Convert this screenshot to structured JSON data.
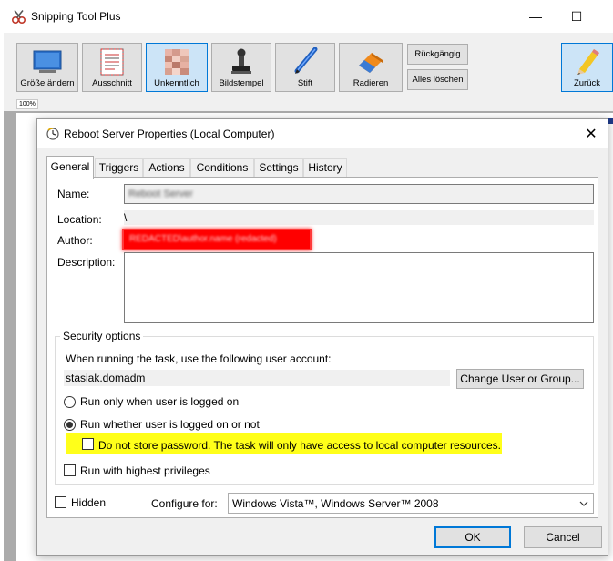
{
  "app": {
    "title": "Snipping Tool Plus",
    "minimize_glyph": "—",
    "maximize_glyph": "☐"
  },
  "toolbar": {
    "tools": [
      {
        "label": "Größe ändern",
        "icon": "monitor-icon"
      },
      {
        "label": "Ausschnitt",
        "icon": "document-crop-icon"
      },
      {
        "label": "Unkenntlich",
        "icon": "pixelate-icon",
        "active": true
      },
      {
        "label": "Bildstempel",
        "icon": "stamp-icon"
      },
      {
        "label": "Stift",
        "icon": "pen-icon"
      },
      {
        "label": "Radieren",
        "icon": "eraser-icon"
      }
    ],
    "undo_label": "Rückgängig",
    "clear_all_label": "Alles löschen",
    "back_label": "Zurück"
  },
  "canvas": {
    "zoom": "100%"
  },
  "dialog": {
    "title": "Reboot Server Properties (Local Computer)",
    "close_glyph": "✕",
    "tabs": [
      "General",
      "Triggers",
      "Actions",
      "Conditions",
      "Settings",
      "History"
    ],
    "active_tab": "General",
    "general": {
      "name_label": "Name:",
      "name_value": "Reboot Server",
      "location_label": "Location:",
      "location_value": "\\",
      "author_label": "Author:",
      "author_value": "REDACTED\\author.name (redacted)",
      "description_label": "Description:",
      "description_value": "",
      "security": {
        "group_title": "Security options",
        "account_prompt": "When running the task, use the following user account:",
        "account_value": "stasiak.domadm",
        "change_user_button": "Change User or Group...",
        "radio_logged_on": "Run only when user is logged on",
        "radio_whether": "Run whether user is logged on or not",
        "selected_radio": "whether",
        "do_not_store_password": "Do not store password.  The task will only have access to local computer resources.",
        "highest_privileges": "Run with highest privileges"
      },
      "hidden_label": "Hidden",
      "configure_label": "Configure for:",
      "configure_value": "Windows Vista™, Windows Server™ 2008"
    },
    "ok_button": "OK",
    "cancel_button": "Cancel"
  },
  "colors": {
    "highlight": "#ffff1a",
    "redaction": "#ff0000",
    "accent": "#0078d7"
  }
}
